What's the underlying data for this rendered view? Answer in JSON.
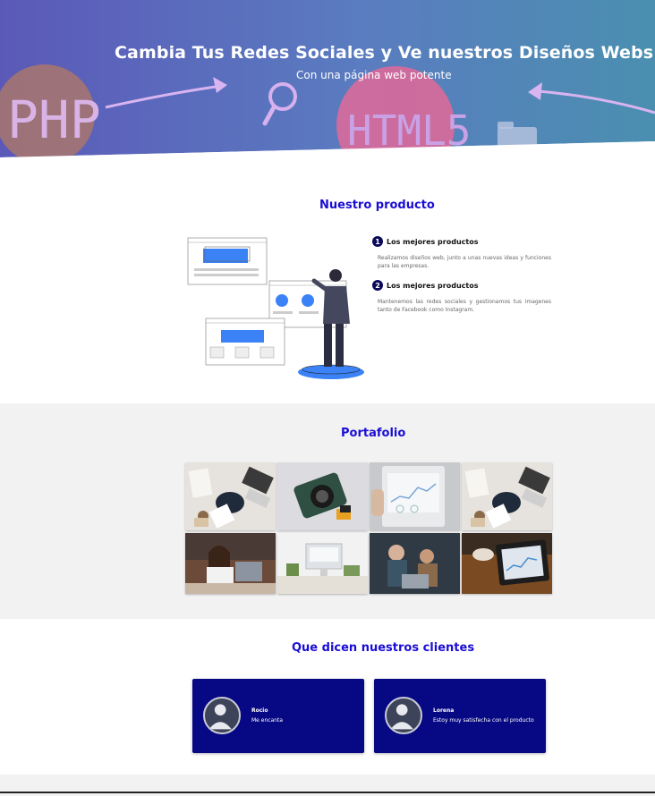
{
  "hero": {
    "title": "Cambia Tus Redes Sociales y Ve nuestros Diseños Webs",
    "subtitle": "Con una página web potente",
    "bg_words": [
      "PHP",
      "HTML5"
    ],
    "colors": {
      "start": "#5b59b8",
      "end": "#4a8fb0"
    }
  },
  "product": {
    "title": "Nuestro producto",
    "features": [
      {
        "number": "1",
        "title": "Los mejores productos",
        "text": "Realizamos diseños web, junto a unas nuevas ideas y funciones para las empresas."
      },
      {
        "number": "2",
        "title": "Los mejores productos",
        "text": "Mantenemos las redes sociales y gestionamos tus imagenes tanto de Facebook como Instagram."
      }
    ]
  },
  "portfolio": {
    "title": "Portafolio",
    "items": [
      {
        "subject": "desk-workspace-overhead"
      },
      {
        "subject": "camera"
      },
      {
        "subject": "tablet-analytics"
      },
      {
        "subject": "desk-workspace-overhead"
      },
      {
        "subject": "woman-laptop"
      },
      {
        "subject": "imac-desk"
      },
      {
        "subject": "team-meeting"
      },
      {
        "subject": "tablet-coffee"
      }
    ]
  },
  "testimonials": {
    "title": "Que dicen nuestros clientes",
    "items": [
      {
        "name": "Rocio",
        "text": "Me encanta"
      },
      {
        "name": "Lorena",
        "text": "Estoy muy satisfecha con el producto"
      }
    ]
  },
  "colors": {
    "accent": "#1a0dd6",
    "card": "#070883",
    "section_bg": "#f2f2f2"
  }
}
